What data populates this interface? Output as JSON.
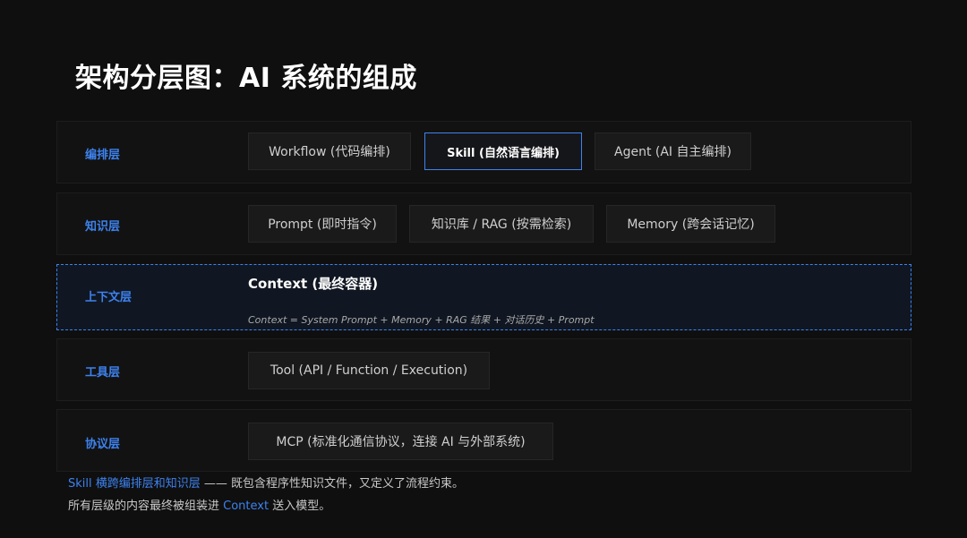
{
  "title": "架构分层图：AI 系统的组成",
  "layers": {
    "orchestration": {
      "label": "编排层",
      "items": [
        "Workflow (代码编排)",
        "Skill (自然语言编排)",
        "Agent (AI 自主编排)"
      ]
    },
    "knowledge": {
      "label": "知识层",
      "items": [
        "Prompt (即时指令)",
        "知识库 / RAG (按需检索)",
        "Memory (跨会话记忆)"
      ]
    },
    "context": {
      "label": "上下文层",
      "title": "Context (最终容器)",
      "formula": "Context = System Prompt + Memory + RAG 结果 + 对话历史 + Prompt"
    },
    "tool": {
      "label": "工具层",
      "items": [
        "Tool (API / Function / Execution)"
      ]
    },
    "protocol": {
      "label": "协议层",
      "items": [
        "MCP (标准化通信协议，连接 AI 与外部系统)"
      ]
    }
  },
  "notes": {
    "line1_highlight": "Skill 横跨编排层和知识层",
    "line1_rest": " —— 既包含程序性知识文件，又定义了流程约束。",
    "line2_pre": "所有层级的内容最终被组装进 ",
    "line2_highlight": "Context",
    "line2_post": " 送入模型。"
  },
  "colors": {
    "accent": "#3d82ee",
    "background": "#0f0f0f"
  }
}
